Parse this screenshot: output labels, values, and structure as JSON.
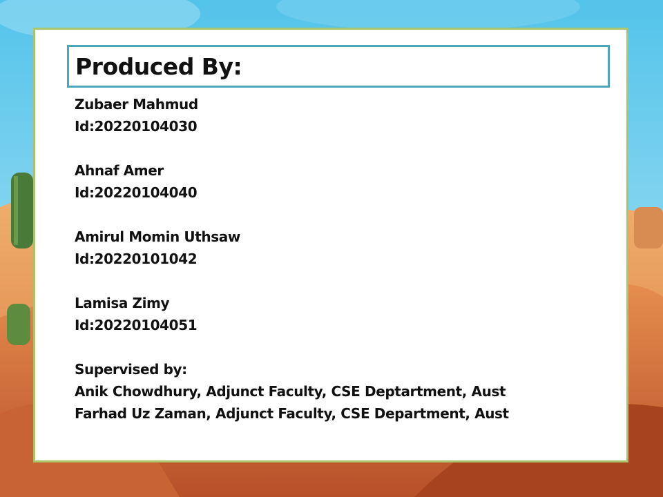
{
  "slide": {
    "title": "Produced By:",
    "members": [
      {
        "name": "Zubaer Mahmud",
        "id": "Id:20220104030"
      },
      {
        "name": "Ahnaf Amer",
        "id": "Id:20220104040"
      },
      {
        "name": "Amirul Momin Uthsaw",
        "id": "Id:20220101042"
      },
      {
        "name": "Lamisa Zimy",
        "id": "Id:20220104051"
      }
    ],
    "supervised_heading": "Supervised by:",
    "supervisors": [
      "Anik Chowdhury, Adjunct Faculty, CSE Deptartment, Aust",
      "Farhad Uz Zaman, Adjunct Faculty, CSE Department, Aust"
    ]
  },
  "colors": {
    "card_border": "#a9c46a",
    "title_border": "#4aa6b8",
    "sky": "#5cc9ea",
    "sand": "#e39a56"
  }
}
